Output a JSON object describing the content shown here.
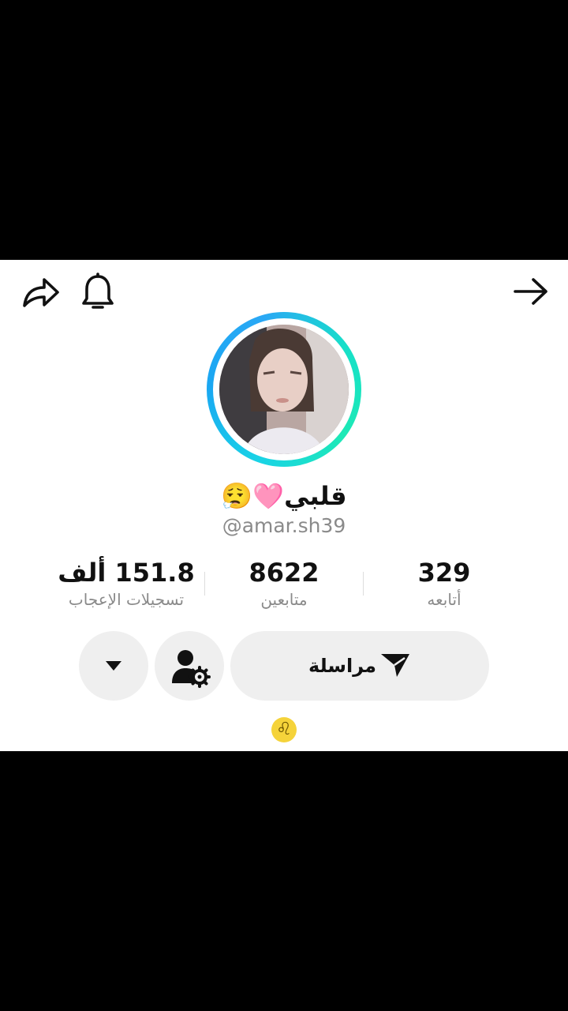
{
  "profile": {
    "display_name": "قلبي🩷😮‍💨",
    "username": "@amar.sh39"
  },
  "stats": {
    "following": {
      "value": "329",
      "label": "أتابعه"
    },
    "followers": {
      "value": "8622",
      "label": "متابعين"
    },
    "likes": {
      "value": "151.8 ألف",
      "label": "تسجيلات الإعجاب"
    }
  },
  "actions": {
    "message_label": "مراسلة"
  },
  "icons": {
    "share": "share-icon",
    "bell": "bell-icon",
    "back": "arrow-right-icon",
    "send": "send-icon",
    "friend_settings": "user-gear-icon",
    "more": "caret-down-icon",
    "zodiac": "leo-zodiac-icon"
  },
  "zodiac_symbol": "♌",
  "colors": {
    "ring_start": "#1aa7f2",
    "ring_end": "#1de9b6",
    "button_bg": "#efefef"
  }
}
